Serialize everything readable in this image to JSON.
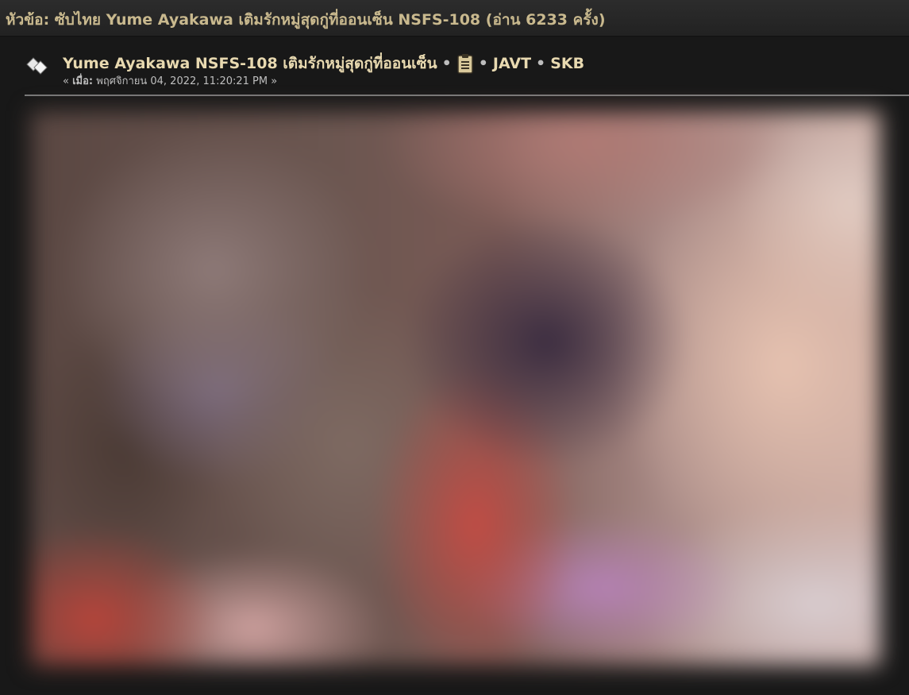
{
  "topic": {
    "title": "หัวข้อ: ซับไทย Yume Ayakawa เติมรักหมู่สุดกู่ที่ออนเซ็น NSFS-108  (อ่าน 6233 ครั้ง)"
  },
  "post": {
    "icon": "post-xx-icon",
    "subject": "Yume Ayakawa NSFS-108 เติมรักหมู่สุดกู่ที่ออนเซ็น",
    "separator": "•",
    "clipboard_icon": "clipboard-icon",
    "board_links": [
      "JAVT",
      "SKB"
    ],
    "date_prefix": "« ",
    "date_label": "เมื่อ:",
    "date_value": " พฤศจิกายน 04, 2022, 11:20:21 PM »"
  },
  "colors": {
    "title": "#c9b98e",
    "subject": "#e8d9b0",
    "background": "#181818"
  },
  "image": {
    "label": "blurred-post-image"
  }
}
